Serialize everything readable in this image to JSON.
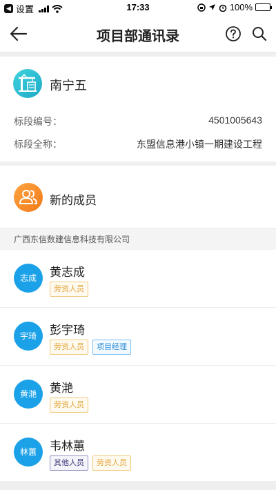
{
  "status_bar": {
    "back_app_label": "设置",
    "time": "17:33",
    "battery": "100%",
    "battery_level": 1.0
  },
  "nav": {
    "title": "项目部通讯录",
    "back_icon": "arrow-left-icon",
    "help_icon": "help-circle-icon",
    "search_icon": "search-icon"
  },
  "project": {
    "name": "南宁五",
    "section_code_label": "标段编号：",
    "section_code": "4501005643",
    "section_full_label": "标段全称：",
    "section_full": "东盟信息港小镇一期建设工程"
  },
  "new_members": {
    "label": "新的成员"
  },
  "company": {
    "name": "广西东信数建信息科技有限公司"
  },
  "members": [
    {
      "avatar": "志成",
      "name": "黄志成",
      "tags": [
        {
          "text": "劳资人员",
          "kind": "labor"
        }
      ]
    },
    {
      "avatar": "宇琦",
      "name": "彭宇琦",
      "tags": [
        {
          "text": "劳资人员",
          "kind": "labor"
        },
        {
          "text": "项目经理",
          "kind": "pm"
        }
      ]
    },
    {
      "avatar": "黄滟",
      "name": "黄滟",
      "tags": [
        {
          "text": "劳资人员",
          "kind": "labor"
        }
      ]
    },
    {
      "avatar": "林蕙",
      "name": "韦林蕙",
      "tags": [
        {
          "text": "其他人员",
          "kind": "other"
        },
        {
          "text": "劳资人员",
          "kind": "labor"
        }
      ]
    }
  ]
}
